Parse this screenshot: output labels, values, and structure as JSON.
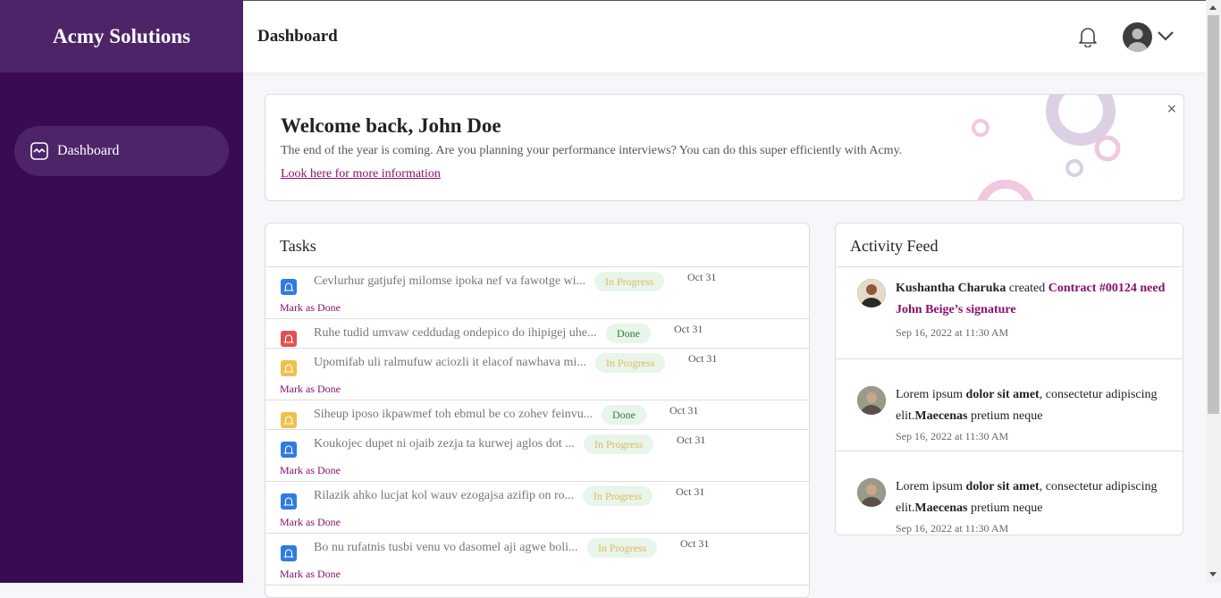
{
  "brand": {
    "name": "Acmy Solutions"
  },
  "sidebar": {
    "items": [
      {
        "label": "Dashboard",
        "icon": "dashboard-icon"
      }
    ]
  },
  "header": {
    "title": "Dashboard"
  },
  "welcome": {
    "title": "Welcome back, John Doe",
    "message": "The end of the year is coming. Are you planning your performance interviews? You can do this super efficiently with Acmy.",
    "link": "Look here for more information",
    "close": "×"
  },
  "tasks": {
    "title": "Tasks",
    "mark_label": "Mark as Done",
    "items": [
      {
        "text": "Cevlurhur gatjufej milomse ipoka nef va fawotge wi...",
        "status": "In Progress",
        "date": "Oct 31",
        "color": "#2f7be0"
      },
      {
        "text": "Ruhe tudid umvaw ceddudag ondepico do ihipigej uhe...",
        "status": "Done",
        "date": "Oct 31",
        "color": "#e05252"
      },
      {
        "text": "Upomifab uli ralmufuw aciozli it elacof nawhava mi...",
        "status": "In Progress",
        "date": "Oct 31",
        "color": "#f0c14a"
      },
      {
        "text": "Siheup iposo ikpawmef toh ebmul be co zohev feinvu...",
        "status": "Done",
        "date": "Oct 31",
        "color": "#f0c14a"
      },
      {
        "text": "Koukojec dupet ni ojaib zezja ta kurwej aglos dot ...",
        "status": "In Progress",
        "date": "Oct 31",
        "color": "#2f7be0"
      },
      {
        "text": "Rilazik ahko lucjat kol wauv ezogajsa azifip on ro...",
        "status": "In Progress",
        "date": "Oct 31",
        "color": "#2f7be0"
      },
      {
        "text": "Bo nu rufatnis tusbi venu vo dasomel aji agwe boli...",
        "status": "In Progress",
        "date": "Oct 31",
        "color": "#2f7be0"
      }
    ]
  },
  "feed": {
    "title": "Activity Feed",
    "items": [
      {
        "author": "Kushantha Charuka",
        "action": " created ",
        "link": "Contract #00124 need John Beige’s signature",
        "time": "Sep 16, 2022 at 11:30 AM"
      },
      {
        "pre": "Lorem ipsum ",
        "bold1": "dolor sit amet",
        "mid": ", consectetur adipiscing elit.",
        "bold2": "Maecenas",
        "post": " pretium neque",
        "time": "Sep 16, 2022 at 11:30 AM"
      },
      {
        "pre": "Lorem ipsum ",
        "bold1": "dolor sit amet",
        "mid": ", consectetur adipiscing elit.",
        "bold2": "Maecenas",
        "post": " pretium neque",
        "time": "Sep 16, 2022 at 11:30 AM"
      }
    ]
  }
}
